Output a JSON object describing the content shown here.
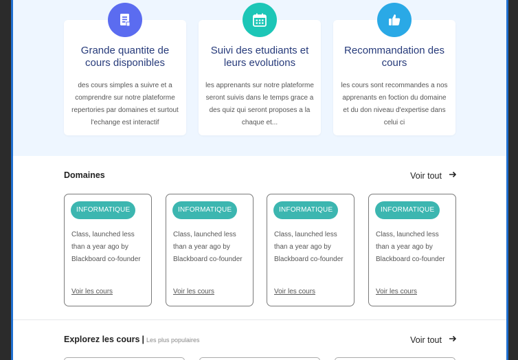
{
  "features": [
    {
      "title": "Grande quantite de cours disponibles",
      "desc": "des cours simples a suivre et a comprendre sur notre plateforme repertories par domaines et surtout l'echange est interactif",
      "icon": "document-icon",
      "color": "#5b6cf0"
    },
    {
      "title": "Suivi des etudiants et leurs evolutions",
      "desc": "les apprenants sur notre plateforme seront suivis dans le temps grace a des quiz qui seront proposes a la  chaque et...",
      "icon": "calendar-icon",
      "color": "#1cc6b7"
    },
    {
      "title": "Recommandation des cours",
      "desc": "les cours sont recommandes a nos apprenants en foction du domaine et du don niveau d'expertise dans celui ci",
      "icon": "thumbs-up-icon",
      "color": "#2aa9e6"
    }
  ],
  "domains_section": {
    "title": "Domaines",
    "see_all": "Voir tout",
    "cards": [
      {
        "badge": "INFORMATIQUE",
        "desc": "Class, launched less than a year ago by Blackboard co-founder",
        "link": "Voir les cours"
      },
      {
        "badge": "INFORMATIQUE",
        "desc": "Class, launched less than a year ago by Blackboard co-founder",
        "link": "Voir les cours"
      },
      {
        "badge": "INFORMATIQUE",
        "desc": "Class, launched less than a year ago by Blackboard co-founder",
        "link": "Voir les cours"
      },
      {
        "badge": "INFORMATIQUE",
        "desc": "Class, launched less than a year ago by Blackboard co-founder",
        "link": "Voir les cours"
      }
    ]
  },
  "explore_section": {
    "title": "Explorez les cours",
    "separator": "|",
    "subtitle": "Les plus populaires",
    "see_all": "Voir tout"
  },
  "colors": {
    "accent_blue": "#1f6fd0",
    "badge_teal": "#3cb6b0",
    "title_navy": "#263a7a",
    "hero_bg": "#eef6ff"
  }
}
